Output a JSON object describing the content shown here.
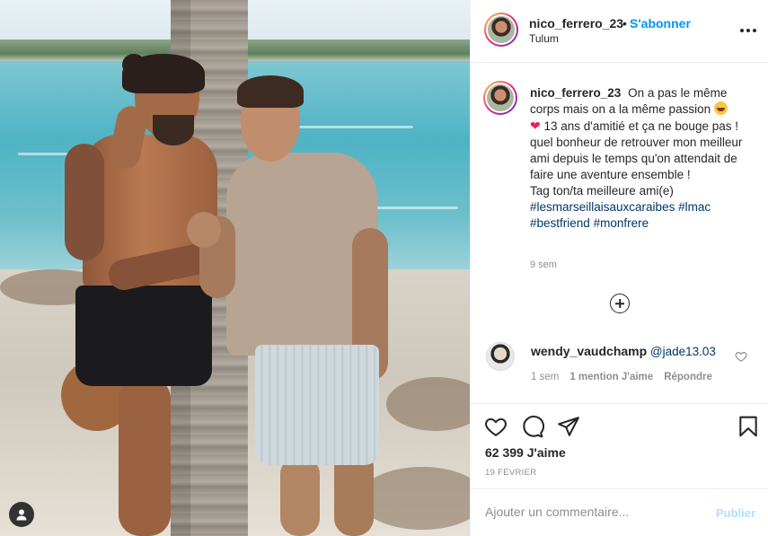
{
  "post": {
    "username": "nico_ferrero_23",
    "separator": "•",
    "follow_label": "S'abonner",
    "location": "Tulum",
    "more_icon": "more-horizontal-icon",
    "caption": {
      "username": "nico_ferrero_23",
      "line1": "On a pas le même corps mais on a la même passion",
      "line2": "13 ans d'amitié et ça ne bouge pas ! quel bonheur de retrouver mon meilleur ami depuis le temps qu'on attendait de faire une aventure ensemble !",
      "line3": "Tag ton/ta meilleure ami(e)",
      "hashtags": [
        "#lesmarseillaisauxcaraibes",
        "#lmac",
        "#bestfriend",
        "#monfrere"
      ],
      "time": "9 sem"
    },
    "comments": [
      {
        "username": "wendy_vaudchamp",
        "text": "@jade13.03",
        "time": "1 sem",
        "likes": "1 mention J'aime",
        "reply": "Répondre"
      }
    ],
    "likes": "62 399 J'aime",
    "date": "19 FÉVRIER",
    "comment_placeholder": "Ajouter un commentaire...",
    "post_label": "Publier",
    "colors": {
      "follow": "#0095f6",
      "hashtag": "#00376b",
      "muted": "#8e8e8e",
      "publish_disabled": "#b2dffc"
    }
  }
}
